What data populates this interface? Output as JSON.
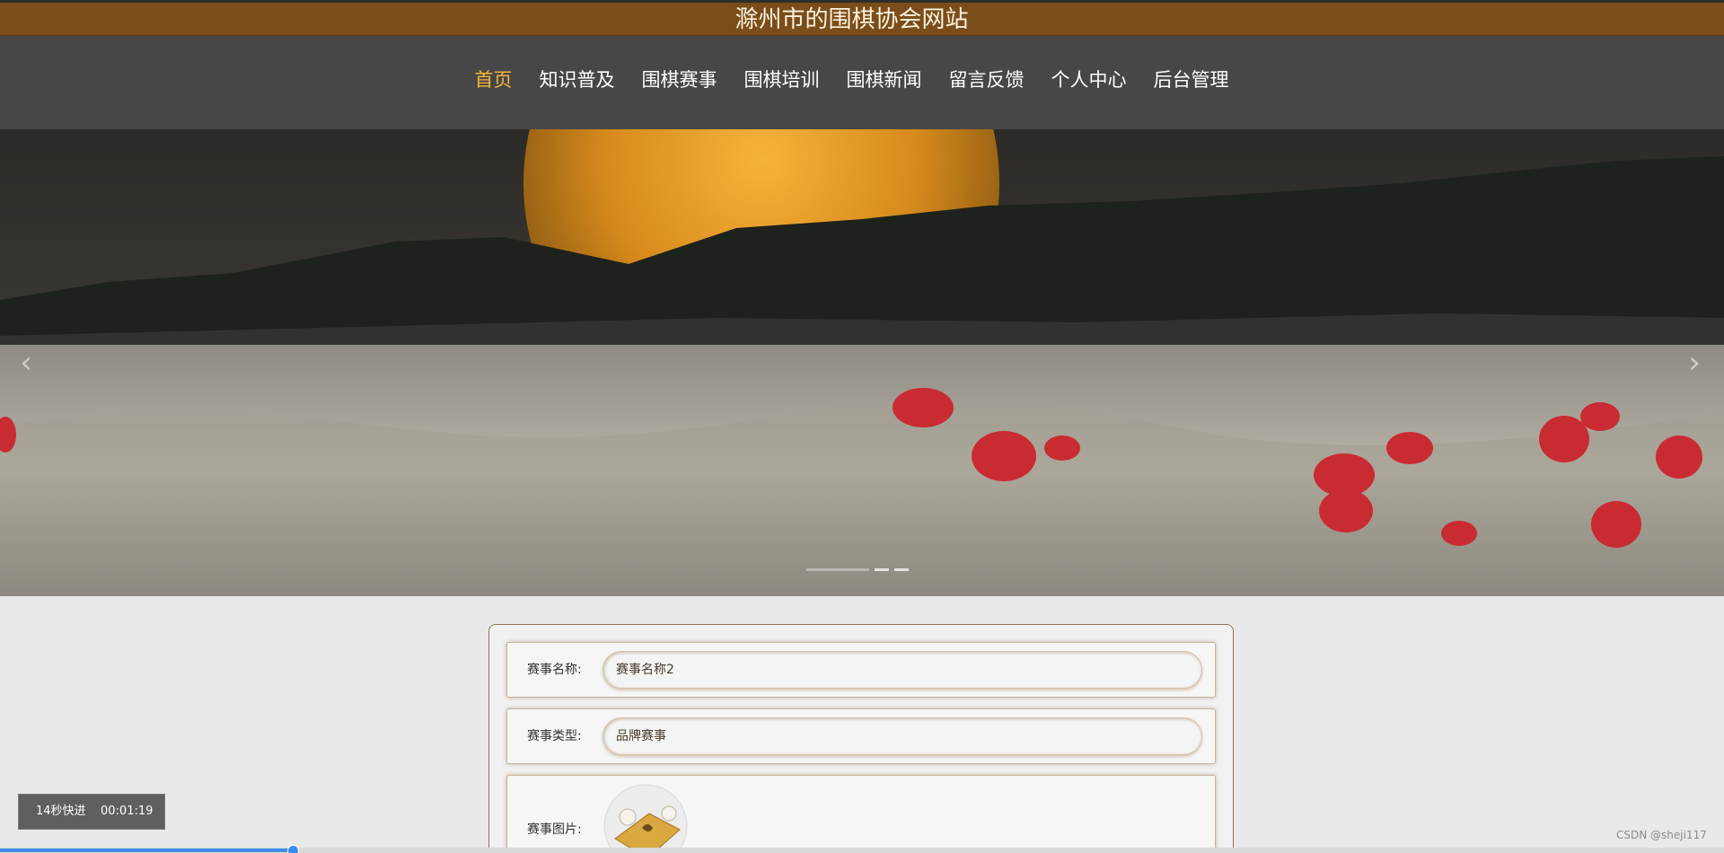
{
  "site": {
    "title": "滁州市的围棋协会网站"
  },
  "nav": {
    "items": [
      {
        "label": "首页",
        "active": true
      },
      {
        "label": "知识普及"
      },
      {
        "label": "围棋赛事"
      },
      {
        "label": "围棋培训"
      },
      {
        "label": "围棋新闻"
      },
      {
        "label": "留言反馈"
      },
      {
        "label": "个人中心"
      },
      {
        "label": "后台管理"
      }
    ]
  },
  "banner": {
    "prev_icon": "chevron-left-icon",
    "next_icon": "chevron-right-icon",
    "slide_count": 3,
    "active_slide": 0
  },
  "form": {
    "name": {
      "label": "赛事名称:",
      "value": "赛事名称2"
    },
    "type": {
      "label": "赛事类型:",
      "value": "品牌赛事"
    },
    "image": {
      "label": "赛事图片:"
    }
  },
  "player": {
    "speed_label": "14秒快进",
    "time": "00:01:19",
    "progress": 0.17
  },
  "watermark": "CSDN @sheji117",
  "colors": {
    "title_bar": "#7a4d1a",
    "nav_bg": "#474747",
    "nav_active": "#f3b43a",
    "progress": "#3b8cf0"
  }
}
